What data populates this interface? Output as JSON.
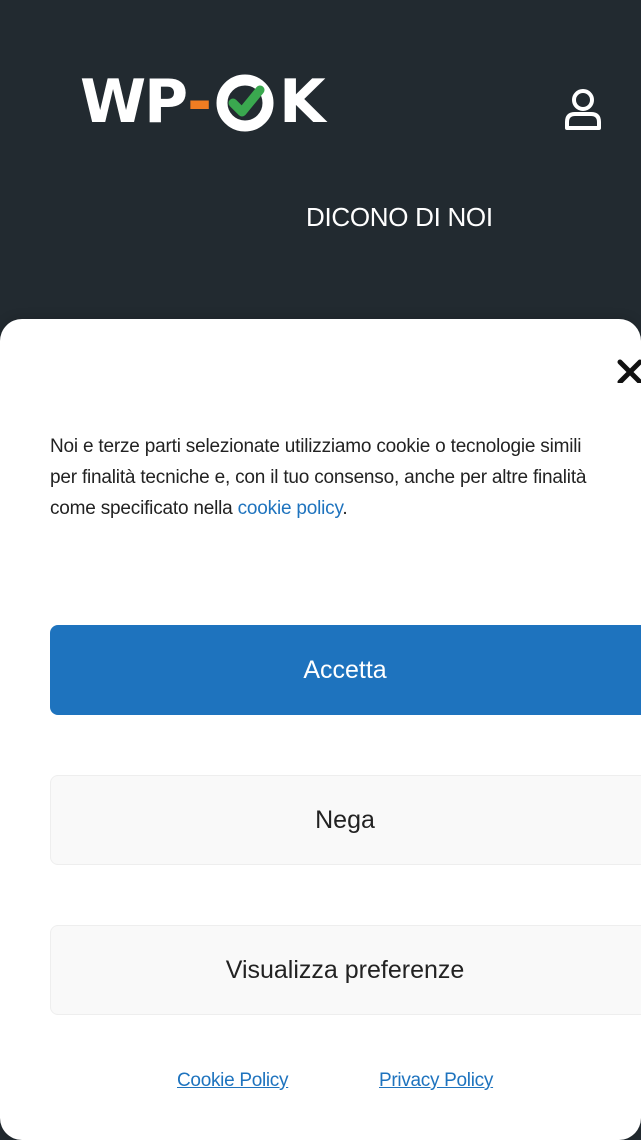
{
  "header": {
    "logo": {
      "part1": "WP",
      "dash": "-",
      "part2": "K",
      "check_color": "#3aa84f",
      "accent_color": "#ef7d22"
    },
    "account_icon": "user-icon",
    "nav_item": "DICONO DI NOI",
    "background": "#222a30"
  },
  "consent": {
    "close_icon": "close-icon",
    "message": {
      "text": "Noi e terze parti selezionate utilizziamo cookie o tecnologie simili per finalità tecniche e, con il tuo consenso, anche per altre finalità come specificato nella ",
      "link": "cookie policy",
      "suffix": "."
    },
    "buttons": {
      "accept": "Accetta",
      "deny": "Nega",
      "preferences": "Visualizza preferenze"
    },
    "links": {
      "cookie_policy": "Cookie Policy",
      "privacy_policy": "Privacy Policy"
    },
    "accent_color": "#1e73be"
  }
}
